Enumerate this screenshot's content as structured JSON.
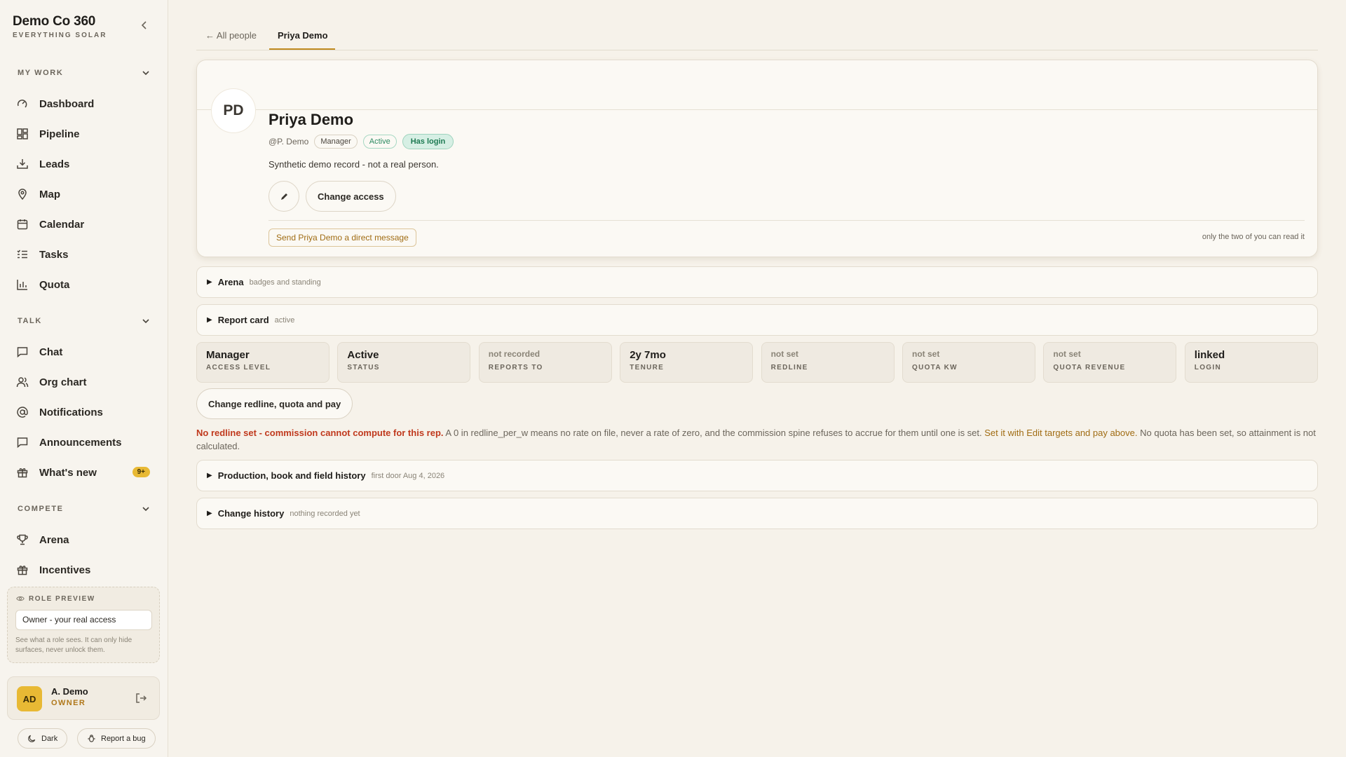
{
  "brand": {
    "name": "Demo Co 360",
    "tagline": "EVERYTHING SOLAR"
  },
  "sidebar": {
    "sections": [
      {
        "label": "MY WORK"
      },
      {
        "label": "TALK"
      },
      {
        "label": "COMPETE"
      }
    ],
    "items": [
      {
        "label": "Dashboard",
        "icon": "dashboard-icon"
      },
      {
        "label": "Pipeline",
        "icon": "pipeline-icon"
      },
      {
        "label": "Leads",
        "icon": "inbox-download-icon"
      },
      {
        "label": "Map",
        "icon": "map-pin-icon"
      },
      {
        "label": "Calendar",
        "icon": "calendar-icon"
      },
      {
        "label": "Tasks",
        "icon": "tasks-list-icon"
      },
      {
        "label": "Quota",
        "icon": "bar-chart-icon"
      },
      {
        "label": "Chat",
        "icon": "chat-bubble-icon"
      },
      {
        "label": "Org chart",
        "icon": "users-icon"
      },
      {
        "label": "Notifications",
        "icon": "at-sign-icon"
      },
      {
        "label": "Announcements",
        "icon": "announcement-icon"
      },
      {
        "label": "What's new",
        "icon": "gift-icon",
        "badge": "9+"
      },
      {
        "label": "Arena",
        "icon": "trophy-icon"
      },
      {
        "label": "Incentives",
        "icon": "gift-box-icon"
      }
    ],
    "role_preview": {
      "label": "ROLE PREVIEW",
      "value": "Owner - your real access",
      "note": "See what a role sees. It can only hide surfaces, never unlock them."
    },
    "user": {
      "initials": "AD",
      "name": "A. Demo",
      "role": "OWNER"
    },
    "footer": {
      "theme_label": "Dark",
      "bug_label": "Report a bug"
    }
  },
  "tabs": {
    "back": "← All people",
    "active": "Priya Demo"
  },
  "profile": {
    "initials": "PD",
    "name": "Priya Demo",
    "handle": "@P. Demo",
    "chips": {
      "role": "Manager",
      "status": "Active",
      "login": "Has login"
    },
    "description": "Synthetic demo record - not a real person.",
    "change_access": "Change access",
    "dm_button": "Send Priya Demo a direct message",
    "dm_note": "only the two of you can read it"
  },
  "sections": {
    "arena": {
      "title": "Arena",
      "sub": "badges and standing"
    },
    "report_card": {
      "title": "Report card",
      "sub": "active"
    },
    "production": {
      "title": "Production, book and field history",
      "sub": "first door Aug 4, 2026"
    },
    "change_history": {
      "title": "Change history",
      "sub": "nothing recorded yet"
    }
  },
  "stats": [
    {
      "value": "Manager",
      "label": "ACCESS LEVEL",
      "muted": false
    },
    {
      "value": "Active",
      "label": "STATUS",
      "muted": false
    },
    {
      "value": "not recorded",
      "label": "REPORTS TO",
      "muted": true
    },
    {
      "value": "2y 7mo",
      "label": "TENURE",
      "muted": false
    },
    {
      "value": "not set",
      "label": "REDLINE",
      "muted": true
    },
    {
      "value": "not set",
      "label": "QUOTA KW",
      "muted": true
    },
    {
      "value": "not set",
      "label": "QUOTA REVENUE",
      "muted": true
    },
    {
      "value": "linked",
      "label": "LOGIN",
      "muted": false
    }
  ],
  "redline_button": "Change redline, quota and pay",
  "warning": {
    "red": "No redline set - commission cannot compute for this rep.",
    "body": " A 0 in redline_per_w means no rate on file, never a rate of zero, and the commission spine refuses to accrue for them until one is set. ",
    "link": "Set it with Edit targets and pay above.",
    "tail": " No quota has been set, so attainment is not calculated."
  }
}
